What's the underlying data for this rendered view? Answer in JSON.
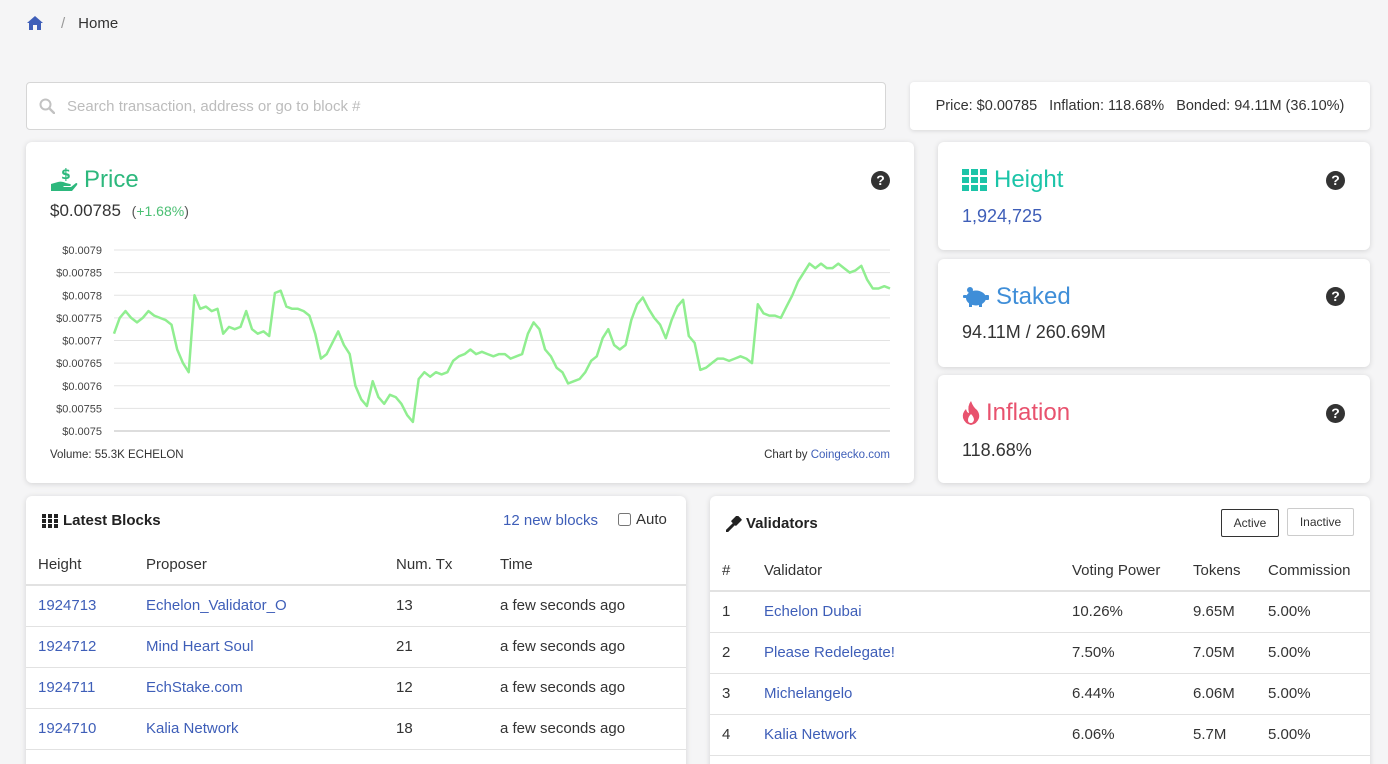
{
  "breadcrumb": {
    "home_label": "Home"
  },
  "search": {
    "placeholder": "Search transaction, address or go to block #"
  },
  "stats_bar": {
    "price": "Price: $0.00785",
    "inflation": "Inflation: 118.68%",
    "bonded": "Bonded: 94.11M (36.10%)"
  },
  "price_card": {
    "title": "Price",
    "value": "$0.00785",
    "change": "+1.68%",
    "volume": "Volume: 55.3K ECHELON",
    "credit_prefix": "Chart by ",
    "credit_link": "Coingecko.com"
  },
  "height_card": {
    "title": "Height",
    "value": "1,924,725"
  },
  "staked_card": {
    "title": "Staked",
    "value": "94.11M / 260.69M"
  },
  "inflation_card": {
    "title": "Inflation",
    "value": "118.68%"
  },
  "blocks": {
    "title": "Latest Blocks",
    "new_blocks": "12 new blocks",
    "auto_label": "Auto",
    "headers": [
      "Height",
      "Proposer",
      "Num. Tx",
      "Time"
    ],
    "rows": [
      {
        "height": "1924713",
        "proposer": "Echelon_Validator_O",
        "txs": "13",
        "time": "a few seconds ago"
      },
      {
        "height": "1924712",
        "proposer": "Mind Heart Soul",
        "txs": "21",
        "time": "a few seconds ago"
      },
      {
        "height": "1924711",
        "proposer": "EchStake.com",
        "txs": "12",
        "time": "a few seconds ago"
      },
      {
        "height": "1924710",
        "proposer": "Kalia Network",
        "txs": "18",
        "time": "a few seconds ago"
      }
    ]
  },
  "validators": {
    "title": "Validators",
    "active_label": "Active",
    "inactive_label": "Inactive",
    "headers": [
      "#",
      "Validator",
      "Voting Power",
      "Tokens",
      "Commission"
    ],
    "rows": [
      {
        "rank": "1",
        "name": "Echelon Dubai",
        "power": "10.26%",
        "tokens": "9.65M",
        "commission": "5.00%"
      },
      {
        "rank": "2",
        "name": "Please Redelegate!",
        "power": "7.50%",
        "tokens": "7.05M",
        "commission": "5.00%"
      },
      {
        "rank": "3",
        "name": "Michelangelo",
        "power": "6.44%",
        "tokens": "6.06M",
        "commission": "5.00%"
      },
      {
        "rank": "4",
        "name": "Kalia Network",
        "power": "6.06%",
        "tokens": "5.7M",
        "commission": "5.00%"
      }
    ]
  },
  "colors": {
    "price_green": "#2db87d",
    "height_teal": "#1bc4a8",
    "staked_blue": "#3f8ed8",
    "inflation_red": "#e8526e",
    "link_blue": "#3e5eb8",
    "chart_line": "#90ee90"
  },
  "chart_data": {
    "type": "line",
    "yticks": [
      "$0.0079",
      "$0.00785",
      "$0.0078",
      "$0.00775",
      "$0.0077",
      "$0.00765",
      "$0.0076",
      "$0.00755",
      "$0.0075"
    ],
    "ylim": [
      0.0075,
      0.0079
    ],
    "grid": true,
    "series": [
      {
        "values": [
          0.007715,
          0.00775,
          0.007765,
          0.00775,
          0.00774,
          0.00775,
          0.007765,
          0.007755,
          0.00775,
          0.007745,
          0.007735,
          0.00768,
          0.00765,
          0.00763,
          0.0078,
          0.00777,
          0.007775,
          0.007765,
          0.00777,
          0.007715,
          0.00773,
          0.007725,
          0.00773,
          0.007765,
          0.007725,
          0.007715,
          0.00772,
          0.00771,
          0.007805,
          0.00781,
          0.007775,
          0.00777,
          0.00777,
          0.007765,
          0.007755,
          0.007715,
          0.00766,
          0.00767,
          0.007695,
          0.00772,
          0.00769,
          0.00767,
          0.0076,
          0.00757,
          0.007555,
          0.00761,
          0.007575,
          0.00756,
          0.00758,
          0.007575,
          0.00756,
          0.007535,
          0.00752,
          0.007615,
          0.00763,
          0.00762,
          0.00763,
          0.007625,
          0.00763,
          0.007655,
          0.007665,
          0.00767,
          0.00768,
          0.00767,
          0.007675,
          0.00767,
          0.007665,
          0.00767,
          0.00767,
          0.00766,
          0.007665,
          0.00767,
          0.007715,
          0.00774,
          0.007725,
          0.00768,
          0.007665,
          0.00764,
          0.00763,
          0.007605,
          0.00761,
          0.007615,
          0.00763,
          0.007655,
          0.007665,
          0.007705,
          0.007725,
          0.00769,
          0.00768,
          0.00769,
          0.007745,
          0.00778,
          0.007795,
          0.00777,
          0.00775,
          0.007735,
          0.007705,
          0.007745,
          0.007775,
          0.00779,
          0.00771,
          0.007695,
          0.007635,
          0.00764,
          0.00765,
          0.00766,
          0.00766,
          0.007655,
          0.00766,
          0.007665,
          0.00766,
          0.00765,
          0.00778,
          0.00776,
          0.007755,
          0.007755,
          0.00775,
          0.007775,
          0.0078,
          0.00783,
          0.00785,
          0.00787,
          0.00786,
          0.00787,
          0.00786,
          0.00786,
          0.00787,
          0.00786,
          0.00785,
          0.007855,
          0.007865,
          0.007835,
          0.007815,
          0.007815,
          0.00782,
          0.007815
        ]
      }
    ]
  }
}
